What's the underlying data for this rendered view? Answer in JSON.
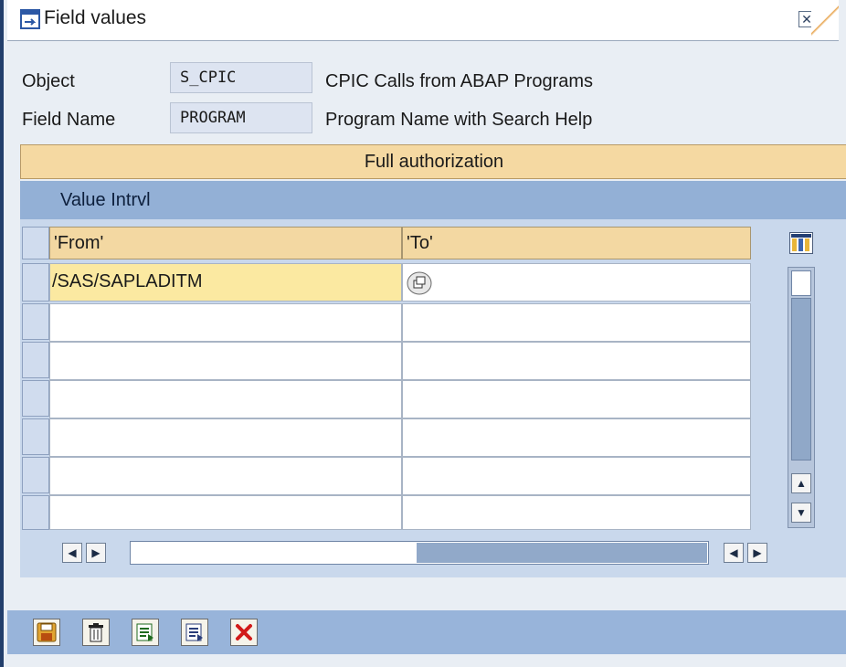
{
  "window": {
    "title": "Field values",
    "close_icon": "close-icon",
    "title_icon": "window-icon"
  },
  "header": {
    "object_label": "Object",
    "object_value": "S_CPIC",
    "object_desc": "CPIC Calls from ABAP Programs",
    "field_label": "Field Name",
    "field_value": "PROGRAM",
    "field_desc": "Program Name with Search Help"
  },
  "full_authorization_label": "Full authorization",
  "value_interval": {
    "title": "Value Intrvl",
    "columns": [
      "'From'",
      "'To'"
    ],
    "rows": [
      {
        "from": "/SAS/SAPLADITM",
        "to": ""
      },
      {
        "from": "",
        "to": ""
      },
      {
        "from": "",
        "to": ""
      },
      {
        "from": "",
        "to": ""
      },
      {
        "from": "",
        "to": ""
      },
      {
        "from": "",
        "to": ""
      },
      {
        "from": "",
        "to": ""
      }
    ]
  },
  "toolbar": {
    "buttons": [
      {
        "name": "save-icon"
      },
      {
        "name": "delete-icon"
      },
      {
        "name": "insert-row-icon"
      },
      {
        "name": "copy-row-icon"
      },
      {
        "name": "cancel-icon"
      }
    ]
  },
  "colors": {
    "header_blue": "#93b0d6",
    "orange_bar": "#f5d9a2",
    "field_blue": "#dde4f1"
  }
}
